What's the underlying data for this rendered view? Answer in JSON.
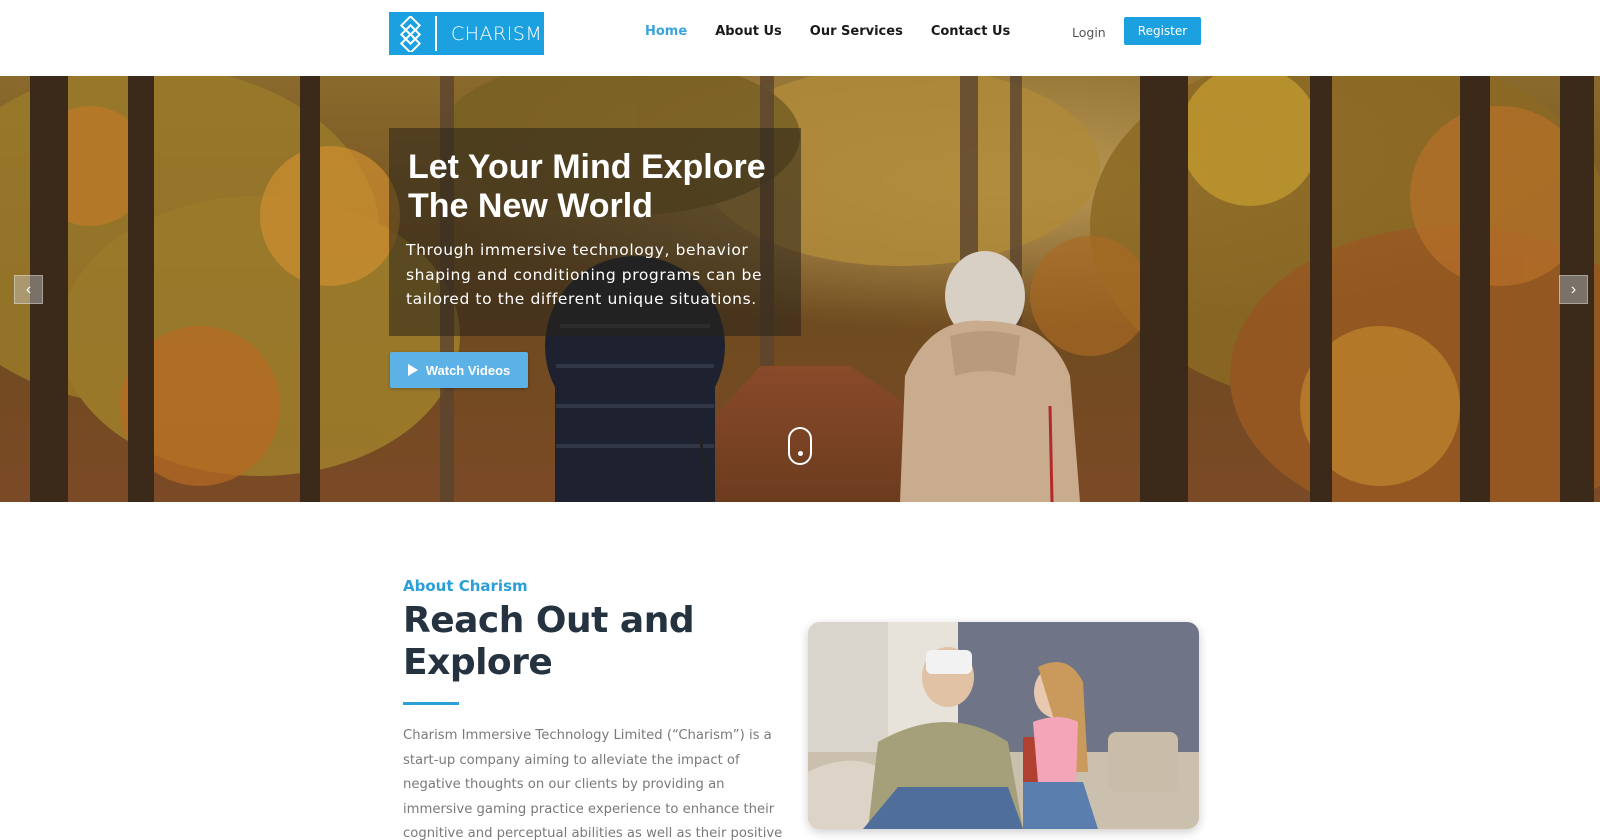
{
  "brand": {
    "name": "CHARISM",
    "accent": "#1ba1df"
  },
  "nav": {
    "items": [
      {
        "label": "Home",
        "active": true
      },
      {
        "label": "About Us",
        "active": false
      },
      {
        "label": "Our Services",
        "active": false
      },
      {
        "label": "Contact Us",
        "active": false
      }
    ],
    "login_label": "Login",
    "register_label": "Register"
  },
  "hero": {
    "title": "Let Your Mind Explore The New World",
    "subtitle": "Through immersive technology, behavior shaping and conditioning programs can be tailored to the different unique situations.",
    "cta_label": "Watch Videos",
    "prev_icon": "chevron-left-icon",
    "next_icon": "chevron-right-icon",
    "scroll_icon": "mouse-scroll-icon"
  },
  "about": {
    "eyebrow": "About Charism",
    "title": "Reach Out and Explore",
    "body": "Charism Immersive Technology Limited (“Charism”) is a start-up company aiming to alleviate the impact of negative thoughts on  our clients by providing an immersive gaming practice experience to enhance their cognitive and perceptual abilities as well as their positive psychological"
  }
}
